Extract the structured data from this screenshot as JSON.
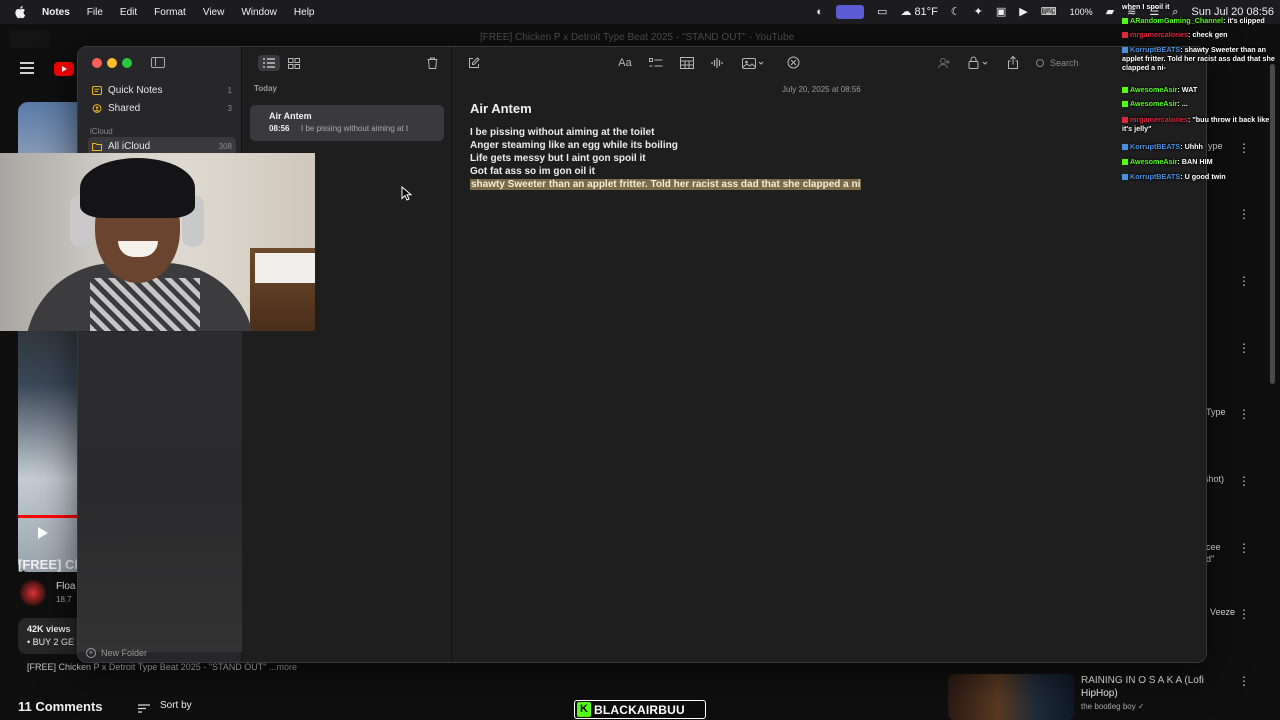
{
  "menubar": {
    "app_name": "Notes",
    "menus": [
      "File",
      "Edit",
      "Format",
      "View",
      "Window",
      "Help"
    ],
    "weather": "81°F",
    "battery": "100%",
    "clock": "Sun Jul 20  08:56"
  },
  "youtube": {
    "tab_title": "[FREE] Chicken P x Detroit Type Beat 2025 - \"STAND OUT\" - YouTube",
    "video_title_fragment": "[FREE] Cl",
    "channel_fragment": "Floa",
    "subs_fragment": "18.7",
    "views": "42K views",
    "buy_fragment": "• BUY 2 GE",
    "description_line": "[FREE] Chicken P x Detroit Type Beat 2025 - \"STAND OUT\"",
    "more": "...more",
    "comments_count": "11 Comments",
    "sort_by": "Sort by",
    "suggestion_fragments": [
      "ype",
      "Type",
      "shot)",
      "cee",
      "d\"",
      "Veeze"
    ],
    "rec_video": {
      "title": "RAINING IN O S A K A (Lofi HipHop)",
      "channel": "the bootleg boy ✓"
    }
  },
  "notes_app": {
    "sidebar": {
      "folders": [
        {
          "label": "Quick Notes",
          "count": "1",
          "icon": "quick-notes-icon"
        },
        {
          "label": "Shared",
          "count": "3",
          "icon": "shared-icon"
        }
      ],
      "icloud_header": "iCloud",
      "icloud_folder": {
        "label": "All iCloud",
        "count": "308"
      },
      "new_folder": "New Folder"
    },
    "list": {
      "section": "Today",
      "note": {
        "title": "Air Antem",
        "time": "08:56",
        "preview": "I be pissing without aiming at t"
      }
    },
    "editor": {
      "date": "July 20, 2025 at 08:56",
      "title": "Air Antem",
      "lines": [
        "I be pissing without aiming at the toilet",
        "Anger steaming like an egg while its boiling",
        "Life gets messy but I aint gon spoil it",
        "Got fat ass so im gon oil it",
        "shawty Sweeter than an applet fritter. Told her racist ass dad that she clapped a ni"
      ],
      "search_placeholder": "Search"
    }
  },
  "chat": [
    {
      "user": "",
      "message": "when I spoil it",
      "color": "#ffffff"
    },
    {
      "user": "ARandomGaming_Channel",
      "message": ": it's clipped",
      "color": "#53fc18"
    },
    {
      "user": "mrgamercalories",
      "message": ": check gen",
      "color": "#e0273b"
    },
    {
      "user": "KorruptBEATS",
      "message": ": shawty Sweeter than an applet fritter. Told her racist ass dad that she clapped a ni-",
      "color": "#4a90e2"
    },
    {
      "user": "AwesomeAsir",
      "message": ": WAT",
      "color": "#53fc18"
    },
    {
      "user": "AwesomeAsir",
      "message": ": ...",
      "color": "#53fc18"
    },
    {
      "user": "mrgamercalories",
      "message": ": \"buu throw it back like it's jelly\"",
      "color": "#e0273b"
    },
    {
      "user": "KorruptBEATS",
      "message": ": Uhhh",
      "color": "#4a90e2"
    },
    {
      "user": "AwesomeAsir",
      "message": ": BAN HIM",
      "color": "#53fc18"
    },
    {
      "user": "KorruptBEATS",
      "message": ": U good twin",
      "color": "#4a90e2"
    }
  ],
  "watermark": "BLACKAIRBUU",
  "colors": {
    "accent_highlight": "#7a6a4a",
    "kick_green": "#53fc18",
    "youtube_red": "#ff0000"
  }
}
